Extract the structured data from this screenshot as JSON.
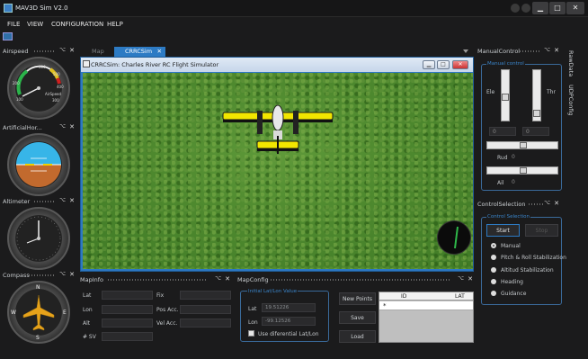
{
  "window": {
    "title": "MAV3D Sim V2.0",
    "controls": {
      "minimize": "▁",
      "maximize": "□",
      "close": "✕"
    }
  },
  "menu": {
    "items": [
      "FILE",
      "VIEW",
      "CONFIGURATION",
      "HELP"
    ]
  },
  "left_panels": {
    "airspeed": {
      "title": "Airspeed",
      "gauge_label": "AirSpeed",
      "ticks": [
        "200",
        "100",
        "600",
        "500",
        "400",
        "300"
      ]
    },
    "attitude": {
      "title": "ArtificialHor..."
    },
    "altimeter": {
      "title": "Altimeter"
    },
    "compass": {
      "title": "Compass",
      "letters": {
        "n": "N",
        "e": "E",
        "s": "S",
        "w": "W"
      }
    }
  },
  "center": {
    "tabs": [
      {
        "label": "Map"
      },
      {
        "label": "CRRCSim"
      }
    ],
    "tab_close": "✕",
    "sim_window_title": "CRRCSim: Charles River RC Flight Simulator"
  },
  "mapinfo": {
    "title": "MapInfo",
    "fields_left": [
      "Lat",
      "Lon",
      "Alt",
      "# SV"
    ],
    "fields_right": [
      "Fix",
      "Pos Acc.",
      "Vel Acc."
    ]
  },
  "mapconfig": {
    "title": "MapConfig",
    "group_title": "Initial Lat/Lon Value",
    "lat_label": "Lat",
    "lat_value": "19.51226",
    "lon_label": "Lon",
    "lon_value": "-99.12526",
    "checkbox_label": "Use diferential Lat/Lon",
    "new_points": "New Points",
    "save": "Save",
    "load": "Load",
    "grid_headers": [
      "ID",
      "LAT"
    ],
    "grid_new_row_marker": "*"
  },
  "manual_control": {
    "title": "ManualControl",
    "group_title": "Manual control",
    "ele_label": "Ele",
    "thr_label": "Thr",
    "ele_value": "0",
    "thr_value": "0",
    "rud_label": "Rud",
    "rud_value": "0",
    "ail_label": "Ail",
    "ail_value": "0"
  },
  "control_selection": {
    "title": "ControlSelection",
    "group_title": "Control Selection",
    "start": "Start",
    "stop": "Stop",
    "modes": [
      "Manual",
      "Pitch & Roll Stabilization",
      "Altitud Stabilization",
      "Heading",
      "Guidance"
    ],
    "selected_mode": "Manual"
  },
  "side_tabs": [
    "RawData",
    "UDPConfig"
  ],
  "panel_buttons": {
    "pin": "⌥",
    "close": "✕"
  },
  "colors": {
    "accent": "#2d7bc4",
    "background": "#1b1b1c",
    "plane_yellow": "#f2e600",
    "grass": "#4f8a2f"
  }
}
